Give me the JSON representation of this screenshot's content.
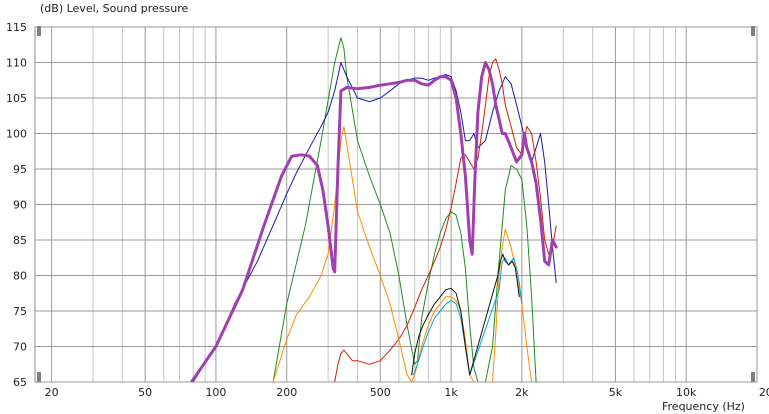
{
  "chart_data": {
    "type": "line",
    "title": "",
    "ylabel": "(dB)  Level, Sound pressure",
    "xlabel": "Frequency  (Hz)",
    "xscale": "log",
    "xlim": [
      17,
      20000
    ],
    "ylim": [
      65,
      115
    ],
    "grid": true,
    "y_ticks": [
      "115",
      "110",
      "105",
      "100",
      "95",
      "90",
      "85",
      "80",
      "75",
      "70",
      "65"
    ],
    "x_ticks": [
      {
        "value": 20,
        "label": "20"
      },
      {
        "value": 50,
        "label": "50"
      },
      {
        "value": 100,
        "label": "100"
      },
      {
        "value": 200,
        "label": "200"
      },
      {
        "value": 500,
        "label": "500"
      },
      {
        "value": 1000,
        "label": "1k"
      },
      {
        "value": 2000,
        "label": "2k"
      },
      {
        "value": 5000,
        "label": "5k"
      },
      {
        "value": 10000,
        "label": "10k"
      },
      {
        "value": 20000,
        "label": "20k"
      }
    ],
    "series": [
      {
        "color": "#228b22",
        "width": 1,
        "x": [
          175,
          200,
          240,
          280,
          320,
          340,
          350,
          360,
          400,
          450,
          500,
          550,
          600,
          650,
          700,
          720,
          750,
          800,
          850,
          900,
          950,
          1000,
          1050,
          1100,
          1150,
          1200,
          1250,
          1300,
          1400,
          1500,
          1600,
          1700,
          1800,
          1900,
          2000,
          2100,
          2200,
          2300
        ],
        "y": [
          65,
          76,
          87,
          99,
          110,
          113.5,
          112,
          108,
          99,
          94,
          90,
          86,
          80,
          73,
          67.5,
          68,
          74,
          79,
          83,
          86,
          88,
          89,
          88.5,
          86,
          81,
          73,
          67,
          65,
          65,
          70,
          82,
          92,
          95.5,
          95,
          93.5,
          87,
          77,
          65
        ]
      },
      {
        "color": "#1a1aa8",
        "width": 1,
        "x": [
          80,
          100,
          120,
          150,
          180,
          200,
          220,
          250,
          280,
          300,
          320,
          340,
          360,
          400,
          450,
          500,
          550,
          600,
          650,
          700,
          750,
          800,
          850,
          900,
          950,
          1000,
          1050,
          1100,
          1150,
          1200,
          1250,
          1300,
          1400,
          1500,
          1600,
          1700,
          1800,
          1900,
          2000,
          2100,
          2200,
          2300,
          2400,
          2500,
          2600,
          2700,
          2800
        ],
        "y": [
          65,
          70,
          76,
          82,
          88,
          91.5,
          94.5,
          98,
          101,
          103,
          106,
          110,
          108,
          105,
          104.5,
          105,
          106,
          107,
          107.5,
          107.8,
          107.8,
          107.5,
          107.8,
          108,
          108.3,
          108,
          106,
          103,
          99,
          99,
          100,
          98,
          99,
          103,
          106,
          108,
          107,
          104,
          101,
          98,
          96,
          98,
          100,
          96,
          90,
          84,
          79
        ]
      },
      {
        "color": "#cc2200",
        "width": 1,
        "x": [
          320,
          330,
          340,
          350,
          360,
          380,
          400,
          450,
          500,
          550,
          600,
          650,
          700,
          750,
          800,
          850,
          900,
          950,
          1000,
          1050,
          1100,
          1150,
          1200,
          1250,
          1300,
          1350,
          1400,
          1450,
          1500,
          1550,
          1600,
          1650,
          1700,
          1800,
          1900,
          2000,
          2100,
          2200,
          2300,
          2400,
          2500,
          2600,
          2700,
          2800
        ],
        "y": [
          65,
          67.5,
          69,
          69.5,
          69,
          68,
          68,
          67.5,
          68,
          69.5,
          71,
          73,
          75.5,
          78,
          80,
          82,
          84,
          86.5,
          89.5,
          93,
          96.5,
          97,
          96,
          95,
          96.5,
          100,
          104,
          108,
          110,
          110.5,
          109,
          107,
          104,
          101,
          98,
          97,
          101,
          100,
          96,
          91,
          85,
          83,
          84,
          87
        ]
      },
      {
        "color": "#ff8c00",
        "width": 1,
        "x": [
          175,
          200,
          220,
          250,
          280,
          300,
          320,
          340,
          350,
          370,
          400,
          450,
          500,
          550,
          600,
          650,
          680,
          700,
          750,
          800,
          850,
          900,
          950,
          1000,
          1050,
          1100,
          1150,
          1200,
          1250,
          1300,
          1400,
          1500,
          1550,
          1600,
          1650,
          1700,
          1800,
          1900,
          2000,
          2100,
          2200
        ],
        "y": [
          65,
          71,
          74.5,
          77,
          80,
          83,
          90,
          99,
          101,
          96,
          89,
          84,
          80,
          76,
          71,
          66,
          65,
          66,
          70,
          73,
          75,
          76,
          77,
          77,
          76.5,
          75,
          71,
          66,
          65,
          65,
          65,
          65,
          72,
          80,
          84,
          86.5,
          84,
          80,
          76,
          70,
          65
        ]
      },
      {
        "color": "#00a8d0",
        "width": 1,
        "x": [
          690,
          720,
          760,
          800,
          850,
          900,
          950,
          1000,
          1050,
          1100,
          1150,
          1200,
          1600,
          1650,
          1700,
          1750,
          1800,
          1850,
          1900,
          1950,
          2000
        ],
        "y": [
          66,
          67.5,
          70,
          72,
          74,
          75,
          76,
          76.5,
          76,
          74,
          70,
          66,
          78,
          82,
          82.5,
          81.5,
          82,
          82.5,
          81,
          79,
          76
        ]
      },
      {
        "color": "#111111",
        "width": 1,
        "x": [
          680,
          700,
          730,
          760,
          800,
          850,
          900,
          950,
          1000,
          1050,
          1100,
          1150,
          1200,
          1580,
          1620,
          1660,
          1700,
          1760,
          1820,
          1880,
          1950
        ],
        "y": [
          66,
          69,
          71.5,
          73,
          74.5,
          76,
          77,
          78,
          78.2,
          77.5,
          75,
          70,
          66,
          80,
          82,
          83,
          82,
          81.5,
          82,
          81,
          77
        ]
      },
      {
        "color": "#a040b0",
        "width": 3,
        "x": [
          75,
          100,
          130,
          160,
          190,
          210,
          230,
          250,
          270,
          285,
          300,
          310,
          315,
          320,
          330,
          340,
          360,
          400,
          450,
          500,
          550,
          600,
          650,
          700,
          750,
          800,
          850,
          900,
          950,
          1000,
          1050,
          1100,
          1150,
          1200,
          1230,
          1260,
          1300,
          1350,
          1400,
          1450,
          1500,
          1550,
          1600,
          1650,
          1700,
          1800,
          1900,
          2000,
          2050,
          2100,
          2200,
          2300,
          2400,
          2500,
          2600,
          2700,
          2800
        ],
        "y": [
          64,
          70,
          78,
          87,
          94,
          96.8,
          97,
          96.8,
          95.5,
          92,
          87,
          83,
          81,
          80.5,
          95,
          106,
          106.5,
          106.3,
          106.5,
          106.8,
          107,
          107.2,
          107.5,
          107.5,
          107,
          106.8,
          107.5,
          108,
          108,
          107.5,
          105,
          100,
          94,
          85,
          83,
          93,
          103,
          108,
          110,
          109,
          107,
          104,
          102,
          100,
          100,
          98,
          96,
          97,
          100,
          98,
          96,
          93,
          88,
          82,
          81.5,
          85,
          84
        ]
      }
    ]
  }
}
